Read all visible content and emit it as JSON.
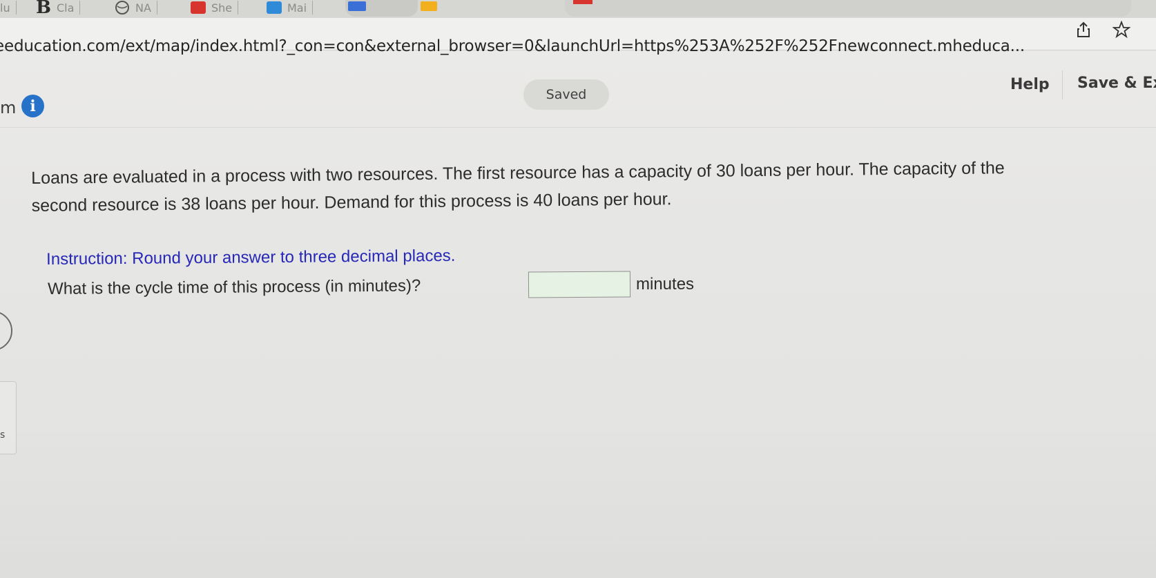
{
  "browser": {
    "tabs": [
      {
        "label": "lu",
        "icon": "tab-favicon"
      },
      {
        "label": "Cla",
        "icon": "bartleby-b-icon"
      },
      {
        "label": "NA",
        "icon": "globe-icon"
      },
      {
        "label": "She",
        "icon": "red-play-icon"
      },
      {
        "label": "Mai",
        "icon": "mail-icon"
      }
    ],
    "url": "education.com/ext/map/index.html?_con=con&external_browser=0&launchUrl=https%253A%252F%252Fnewconnect.mheduca...",
    "url_prefix": "e",
    "bartleby_letter": "B"
  },
  "header": {
    "left_letter": "m",
    "info_icon_glyph": "i",
    "status": "Saved",
    "help_label": "Help",
    "save_exit_label": "Save & Ex"
  },
  "question": {
    "text_line1": "Loans are evaluated in a process with two resources. The first resource has a capacity of 30 loans per hour. The capacity of the",
    "text_line2": "second resource is 38 loans per hour. Demand for this process is 40 loans per hour.",
    "instruction": "Instruction: Round your answer to three decimal places.",
    "prompt": "What is the cycle time of this process (in minutes)?",
    "answer_value": "",
    "unit": "minutes"
  },
  "left_edge": {
    "s_letter": "s"
  },
  "colors": {
    "info_blue": "#2672c9",
    "instruction_blue": "#2727b8",
    "input_fill": "#e6f2e3"
  }
}
